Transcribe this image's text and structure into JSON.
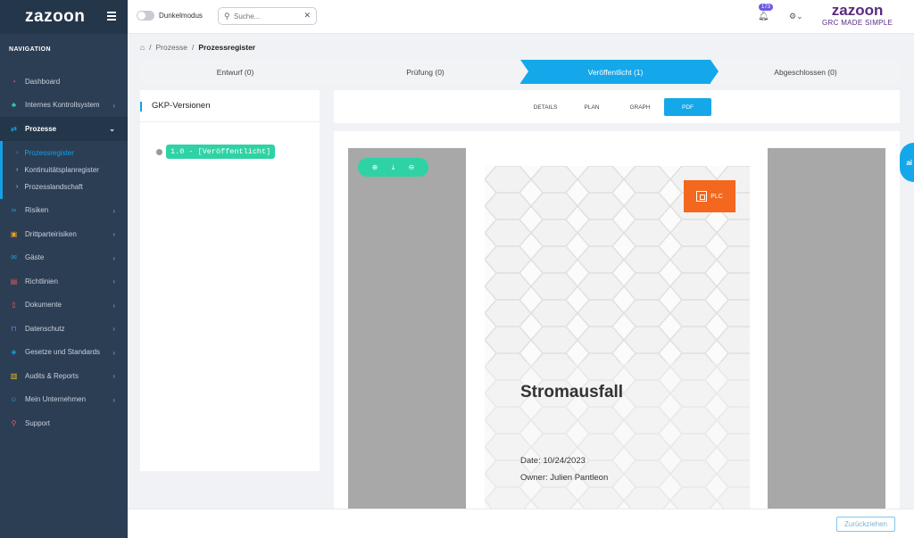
{
  "sidebar": {
    "logo": "zazoon",
    "section_label": "NAVIGATION",
    "items": [
      {
        "label": "Dashboard",
        "icon": "dashboard-icon",
        "color": "#e85c5c"
      },
      {
        "label": "Internes Kontrollsystem",
        "icon": "tree-icon",
        "color": "#2fd2a4"
      },
      {
        "label": "Prozesse",
        "icon": "process-icon",
        "color": "#14a0e3",
        "active": true
      },
      {
        "label": "Risiken",
        "icon": "risk-icon",
        "color": "#14a0e3"
      },
      {
        "label": "Drittparteirisiken",
        "icon": "box-icon",
        "color": "#f0a020"
      },
      {
        "label": "Gäste",
        "icon": "mail-icon",
        "color": "#14a0e3"
      },
      {
        "label": "Richtlinien",
        "icon": "document-icon",
        "color": "#e85c5c"
      },
      {
        "label": "Dokumente",
        "icon": "file-icon",
        "color": "#e85c5c"
      },
      {
        "label": "Datenschutz",
        "icon": "lock-icon",
        "color": "#8e7bd8"
      },
      {
        "label": "Gesetze und Standards",
        "icon": "shield-icon",
        "color": "#14a0e3"
      },
      {
        "label": "Audits & Reports",
        "icon": "chart-icon",
        "color": "#f0c020"
      },
      {
        "label": "Mein Unternehmen",
        "icon": "users-icon",
        "color": "#14a0e3"
      },
      {
        "label": "Support",
        "icon": "search-icon",
        "color": "#e85c5c"
      }
    ],
    "subitems": [
      {
        "label": "Prozessregister",
        "active": true
      },
      {
        "label": "Kontinuitätsplanregister"
      },
      {
        "label": "Prozesslandschaft"
      }
    ]
  },
  "topbar": {
    "dark_mode_label": "Dunkelmodus",
    "search_placeholder": "Suche...",
    "notification_count": "173",
    "brand_name": "zazoon",
    "brand_tagline": "GRC MADE SIMPLE"
  },
  "breadcrumb": {
    "items": [
      "Prozesse",
      "Prozessregister"
    ]
  },
  "stepper": {
    "steps": [
      "Entwurf (0)",
      "Prüfung (0)",
      "Veröffentlicht (1)",
      "Abgeschlossen (0)"
    ],
    "current_index": 2
  },
  "versions": {
    "title": "GKP-Versionen",
    "items": [
      "1.0 - [Veröffentlicht]"
    ]
  },
  "tabs": [
    "DETAILS",
    "PLAN",
    "GRAPH",
    "PDF"
  ],
  "active_tab": "PDF",
  "document": {
    "logo_text": "PLC",
    "title": "Stromausfall",
    "date": "Date: 10/24/2023",
    "owner": "Owner: Julien Pantleon"
  },
  "ai_tab_label": "ai",
  "footer": {
    "back_button": "Zurückziehen"
  },
  "colors": {
    "accent": "#14a8eb",
    "success": "#2fd2a4",
    "sidebar_bg": "#2c3e54",
    "brand": "#5a2a82",
    "plc_orange": "#f4671e"
  }
}
